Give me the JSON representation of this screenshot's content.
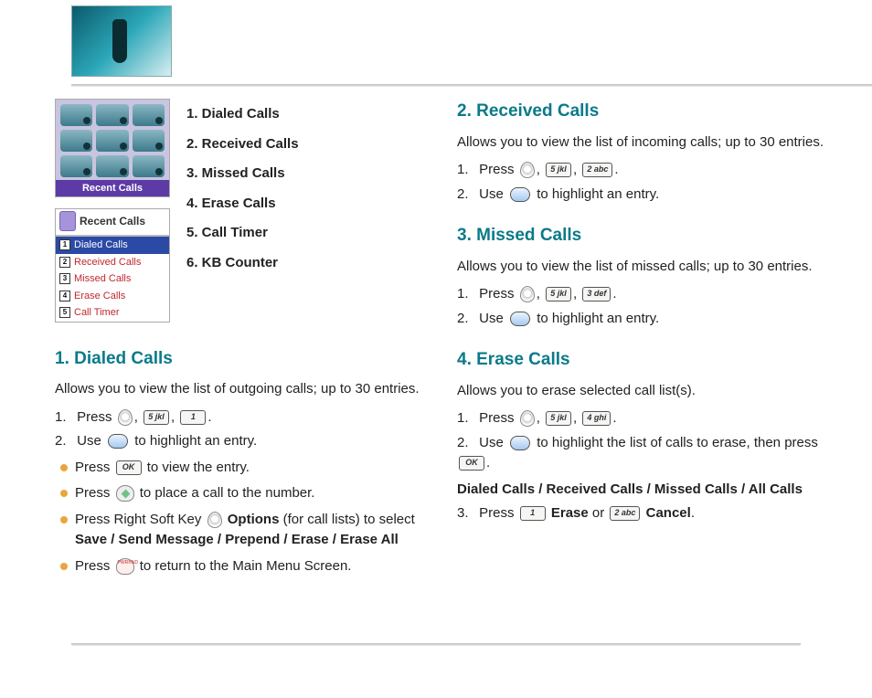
{
  "thumbs": {
    "grid_label": "Recent Calls",
    "list_title": "Recent Calls",
    "rows": [
      {
        "n": "1",
        "label": "Dialed Calls",
        "selected": true
      },
      {
        "n": "2",
        "label": "Received Calls"
      },
      {
        "n": "3",
        "label": "Missed Calls"
      },
      {
        "n": "4",
        "label": "Erase Calls"
      },
      {
        "n": "5",
        "label": "Call Timer"
      }
    ]
  },
  "toc": [
    "1. Dialed Calls",
    "2. Received Calls",
    "3. Missed Calls",
    "4. Erase Calls",
    "5. Call Timer",
    "6. KB Counter"
  ],
  "keys": {
    "k5": "5 jkl",
    "k1": "1 ",
    "k2": "2 abc",
    "k3": "3 def",
    "k4": "4 ghi",
    "ok": "OK"
  },
  "dialed": {
    "heading": "1. Dialed Calls",
    "desc": "Allows you to view the list of outgoing calls; up to 30 entries.",
    "s1_a": "Press",
    "s2_a": "Use",
    "s2_b": "to highlight an entry.",
    "b1_a": "Press",
    "b1_b": "to view the entry.",
    "b2_a": "Press",
    "b2_b": "to place a call to the number.",
    "b3_a": "Press Right Soft Key",
    "b3_b": "Options",
    "b3_c": "(for call lists) to select",
    "b3_d": "Save / Send Message / Prepend / Erase / Erase All",
    "b4_a": "Press",
    "b4_b": "to return to the Main Menu Screen."
  },
  "received": {
    "heading": "2. Received Calls",
    "desc": "Allows you to view the list of incoming calls; up to 30 entries.",
    "s1_a": "Press",
    "s2_a": "Use",
    "s2_b": "to highlight an entry."
  },
  "missed": {
    "heading": "3. Missed Calls",
    "desc": "Allows you to view the list of missed calls; up to 30 entries.",
    "s1_a": "Press",
    "s2_a": "Use",
    "s2_b": "to highlight an entry."
  },
  "erase": {
    "heading": "4. Erase Calls",
    "desc": "Allows you to erase selected call list(s).",
    "s1_a": "Press",
    "s2_a": "Use",
    "s2_b": "to highlight the list of calls to erase, then press",
    "s2_c": ".",
    "list": "Dialed Calls / Received Calls / Missed Calls / All Calls",
    "s3_a": "Press",
    "s3_b": "Erase",
    "s3_or": "or",
    "s3_c": "Cancel",
    "s3_d": "."
  },
  "comma": ",",
  "period": "."
}
